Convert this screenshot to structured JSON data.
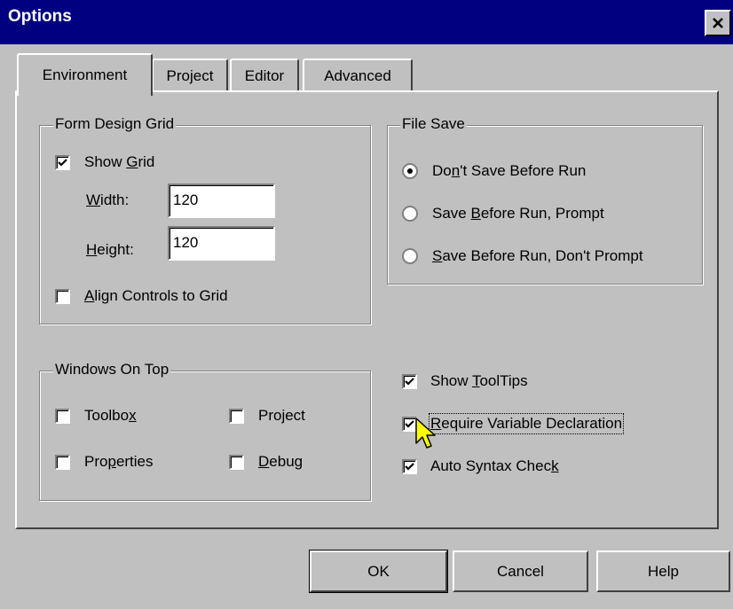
{
  "window": {
    "title": "Options"
  },
  "tabs": [
    {
      "label": "Environment",
      "active": true
    },
    {
      "label": "Project"
    },
    {
      "label": "Editor"
    },
    {
      "label": "Advanced"
    }
  ],
  "form_design_grid": {
    "label": "Form Design Grid",
    "show_grid": {
      "pre": "Show ",
      "key": "G",
      "post": "rid",
      "checked": true
    },
    "width": {
      "pre": "",
      "key": "W",
      "post": "idth:",
      "value": "120"
    },
    "height": {
      "pre": "",
      "key": "H",
      "post": "eight:",
      "value": "120"
    },
    "align": {
      "pre": "",
      "key": "A",
      "post": "lign Controls to Grid",
      "checked": false
    }
  },
  "file_save": {
    "label": "File Save",
    "options": [
      {
        "pre": "Do",
        "key": "n",
        "post": "'t Save Before Run",
        "selected": true
      },
      {
        "pre": "Save ",
        "key": "B",
        "post": "efore Run, Prompt",
        "selected": false
      },
      {
        "pre": "",
        "key": "S",
        "post": "ave Before Run, Don't Prompt",
        "selected": false
      }
    ]
  },
  "windows_on_top": {
    "label": "Windows On Top",
    "toolbox": {
      "pre": "Toolbo",
      "key": "x",
      "post": "",
      "checked": false
    },
    "project": {
      "pre": "Project",
      "key": "",
      "post": "",
      "checked": false
    },
    "properties": {
      "pre": "Pro",
      "key": "p",
      "post": "erties",
      "checked": false
    },
    "debug": {
      "pre": "",
      "key": "D",
      "post": "ebug",
      "checked": false
    }
  },
  "misc": {
    "tooltips": {
      "pre": "Show ",
      "key": "T",
      "post": "oolTips",
      "checked": true
    },
    "require": {
      "pre": "",
      "key": "R",
      "post": "equire Variable Declaration",
      "checked": true
    },
    "syntax": {
      "pre": "Auto Syntax Chec",
      "key": "k",
      "post": "",
      "checked": true
    }
  },
  "buttons": {
    "ok": "OK",
    "cancel": "Cancel",
    "help": "Help"
  }
}
